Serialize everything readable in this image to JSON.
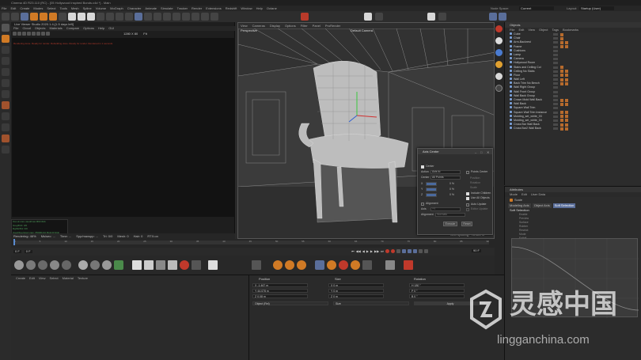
{
  "app": {
    "title": "Cinema 4D R23.110 (RC) - [05 Hollywood Inspired Bonds.c4d *] - Main",
    "menu": [
      "File",
      "Edit",
      "Create",
      "Modes",
      "Select",
      "Tools",
      "Mesh",
      "Spline",
      "Volume",
      "MoGraph",
      "Character",
      "Animate",
      "Simulate",
      "Tracker",
      "Render",
      "Extensions",
      "Redshift",
      "Window",
      "Help",
      "Octane"
    ],
    "node_space_label": "Node Space:",
    "node_space_value": "Current (Standard/Physical)",
    "layout_label": "Layout:",
    "layout_value": "Startup (User)"
  },
  "ipr": {
    "title": "Live Viewer Studio 2020.1.4-[1.5 days left]",
    "menu": [
      "File",
      "Cloud",
      "Objects",
      "Materials",
      "Compare",
      "Options",
      "Help",
      "GUI"
    ],
    "resolution": "1280 X 80",
    "fit": "Fit",
    "log_line": "Rendering done. Ready for render. Rebuilding done. Ready for render. Rendered in 1 seconds",
    "console": [
      "Out-of-core used/max:0Kb/4Gb",
      "Grey8/16: 0/0",
      "Rgb32/64: 0/0",
      "Used/free/total vram: 850Mb/10.8Gb/10.9Gb"
    ],
    "status": [
      "Rendering: 46%",
      "Ms/sec: ...",
      "Time: ...",
      "Spp/maxspp: ...",
      "Tri: 0/0",
      "Mesh: 0",
      "Hair: 0",
      "RTX:on"
    ]
  },
  "viewport": {
    "menu": [
      "View",
      "Cameras",
      "Display",
      "Options",
      "Filter",
      "Panel",
      "ProRender"
    ],
    "label": "Perspective",
    "camera_label": "Default Camera",
    "grid_spacing": "Grid Spacing : 78.489 m"
  },
  "axis_dialog": {
    "title": "Axis Center",
    "center_label": "Center",
    "points_label": "Points Center",
    "action_label": "Action",
    "action_value": "Axis to",
    "center_field_label": "Center",
    "center_field_value": "All Points",
    "position_label": "Position",
    "rotation_label": "Rotation",
    "scale_label": "Scale",
    "x_label": "X",
    "y_label": "Y",
    "z_label": "Z",
    "x_value": "0 %",
    "y_value": "0 %",
    "z_value": "0 %",
    "include_children": "Include Children",
    "use_all_objects": "Use All Objects",
    "alignment_label": "Alignment",
    "axis_label": "Axis",
    "axis_value": "+Y",
    "auto_update": "Auto Update",
    "editor_update": "Editor Update",
    "alignment_field_label": "Alignment",
    "alignment_field_value": "Normals",
    "execute": "Execute",
    "reset": "Reset"
  },
  "objects": {
    "tab": "Objects",
    "menu": [
      "File",
      "Edit",
      "View",
      "Object",
      "Tags",
      "Bookmarks"
    ],
    "items": [
      {
        "name": "Cube",
        "tags": 1,
        "sel": false
      },
      {
        "name": "Chair",
        "tags": 1,
        "sel": false
      },
      {
        "name": "Arm-Backrest",
        "tags": 2,
        "sel": false
      },
      {
        "name": "Frame",
        "tags": 2,
        "sel": false
      },
      {
        "name": "Cushions",
        "tags": 0,
        "sel": false
      },
      {
        "name": "Lamp",
        "tags": 0,
        "sel": false
      },
      {
        "name": "Camera",
        "tags": 0,
        "sel": false
      },
      {
        "name": "Hollywood Room",
        "tags": 0,
        "sel": false
      },
      {
        "name": "Stairs and Ceiling Col",
        "tags": 1,
        "sel": false
      },
      {
        "name": "Ceiling No Slabs",
        "tags": 2,
        "sel": false
      },
      {
        "name": "Floor",
        "tags": 2,
        "sel": false
      },
      {
        "name": "Wall Left",
        "tags": 2,
        "sel": false
      },
      {
        "name": "Back Trim No Bench",
        "tags": 2,
        "sel": false
      },
      {
        "name": "Wall Right Group",
        "tags": 0,
        "sel": false
      },
      {
        "name": "Wall Front Group",
        "tags": 0,
        "sel": false
      },
      {
        "name": "Wall Back Group",
        "tags": 0,
        "sel": false
      },
      {
        "name": "Crown Mold Wall Back",
        "tags": 2,
        "sel": false
      },
      {
        "name": "Wall Back",
        "tags": 2,
        "sel": false
      },
      {
        "name": "Square Wall Trim",
        "tags": 0,
        "sel": false
      },
      {
        "name": "Square Wall Trim Instance",
        "tags": 2,
        "sel": false
      },
      {
        "name": "Molding_set_white_03",
        "tags": 2,
        "sel": false
      },
      {
        "name": "Molding_set_white_04",
        "tags": 2,
        "sel": false
      },
      {
        "name": "Cross Bar Wall Back",
        "tags": 2,
        "sel": false
      },
      {
        "name": "Cross Bar2 Wall Back",
        "tags": 2,
        "sel": false
      }
    ]
  },
  "attributes": {
    "tab": "Attributes",
    "menu": [
      "Mode",
      "Edit",
      "User Data"
    ],
    "mode_label": "Scale",
    "tabs": [
      "Modeling Axis",
      "Object Axis",
      "Soft Selection"
    ],
    "section": "Soft Selection",
    "fields": [
      "Enable",
      "Preview",
      "Surface",
      "Rubber",
      "Restrict",
      "Mode",
      "Falloff",
      "Radius",
      "Strength",
      "Width"
    ]
  },
  "timeline": {
    "start": "0 F",
    "end": "90 F",
    "current": "0 F",
    "ticks": [
      "0",
      "5",
      "10",
      "15",
      "20",
      "25",
      "30",
      "35",
      "40",
      "45",
      "50",
      "55",
      "60",
      "65",
      "70",
      "75",
      "80",
      "85",
      "90"
    ]
  },
  "materials": {
    "menu": [
      "Create",
      "Edit",
      "View",
      "Select",
      "Material",
      "Texture"
    ]
  },
  "coordinates": {
    "position_header": "Position",
    "size_header": "Size",
    "rotation_header": "Rotation",
    "pos": [
      "X  -1.467 m",
      "Y  44.078 m",
      "Z  0.08 m"
    ],
    "size": [
      "X  0 m",
      "Y  0 m",
      "Z  0 m"
    ],
    "rot": [
      "H  180 °",
      "P  0 °",
      "B  0 °"
    ],
    "coord_mode": "Object (Rel)",
    "size_mode": "Size",
    "apply": "Apply"
  },
  "watermark": {
    "cn": "灵感中国",
    "url": "lingganchina.com"
  },
  "colors": {
    "accent_orange": "#d07a25",
    "selection_blue": "#3f5173",
    "highlight_blue": "#5a6e9a",
    "render_red": "#b83a2a"
  }
}
